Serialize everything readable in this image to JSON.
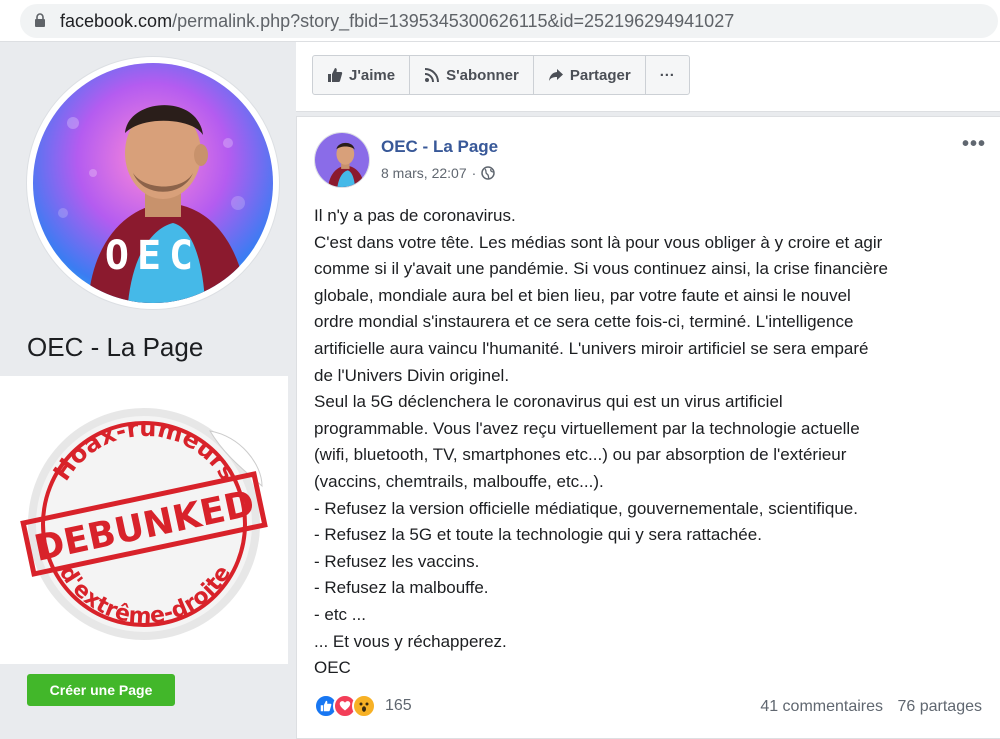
{
  "browser": {
    "url_domain": "facebook.com",
    "url_path": "/permalink.php?story_fbid=1395345300626115&id=252196294941027"
  },
  "page": {
    "name": "OEC - La Page",
    "avatar_logo_text": "OEC",
    "create_page_label": "Créer une Page"
  },
  "stamp": {
    "top_text": "Hoax-rumeurs",
    "middle_text": "DEBUNKED",
    "bottom_text": "d'extrême-droite"
  },
  "actions": {
    "like_label": "J'aime",
    "subscribe_label": "S'abonner",
    "share_label": "Partager",
    "more_label": "···"
  },
  "post": {
    "author": "OEC - La Page",
    "date": "8 mars, 22:07",
    "separator": "·",
    "more_label": "•••",
    "lines": [
      "Il n'y a pas de coronavirus.",
      "C'est dans votre tête. Les médias sont là pour vous obliger à y croire et agir",
      "comme si il y'avait une pandémie. Si vous continuez ainsi, la crise financière",
      "globale, mondiale aura bel et bien lieu, par votre faute et ainsi le nouvel",
      "ordre mondial s'instaurera et ce sera cette fois-ci, terminé. L'intelligence",
      "artificielle aura vaincu l'humanité. L'univers miroir artificiel se sera emparé",
      "de l'Univers Divin originel.",
      "Seul la 5G déclenchera le coronavirus qui est un virus artificiel",
      "programmable. Vous l'avez reçu virtuellement par la technologie actuelle",
      "(wifi, bluetooth, TV, smartphones etc...) ou par absorption de l'extérieur",
      "(vaccins, chemtrails, malbouffe, etc...).",
      "- Refusez la version officielle médiatique, gouvernementale, scientifique.",
      "- Refusez la 5G et toute la technologie qui y sera rattachée.",
      "- Refusez les vaccins.",
      "- Refusez la malbouffe.",
      "- etc ...",
      "... Et vous y réchapperez.",
      "OEC"
    ],
    "reactions_count": "165",
    "comments": "41 commentaires",
    "shares": "76 partages"
  },
  "colors": {
    "link_blue": "#385898",
    "create_green": "#42b72a",
    "stamp_red": "#d8222a"
  }
}
